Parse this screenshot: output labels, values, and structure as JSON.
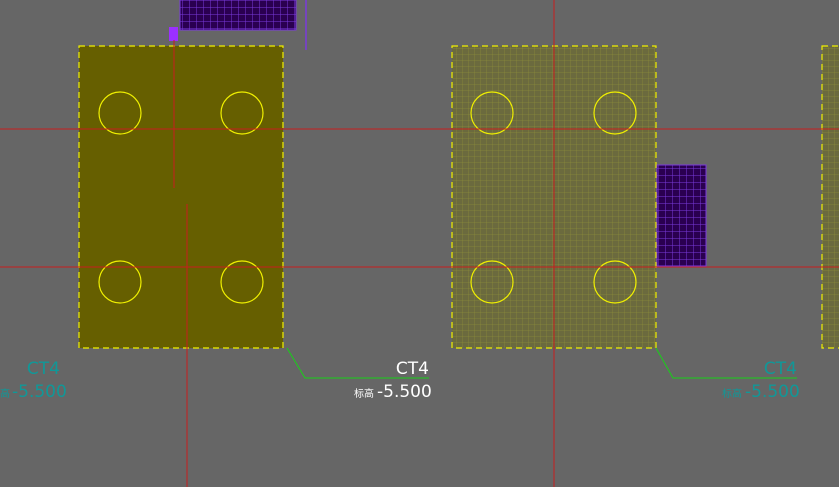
{
  "colors": {
    "background": "#666666",
    "axis_line": "#c81e1e",
    "pile_cap_fill": "#665f00",
    "pile_cap_outline": "#f0f000",
    "pile_circle": "#f0f000",
    "hatch_grid": "#8a8a3a",
    "column_fill": "#2a0050",
    "column_grid": "#7a3adc",
    "leader_line": "#18d018",
    "label_white": "#ffffff",
    "label_teal": "#109898"
  },
  "labels": {
    "left": {
      "code": "CT4",
      "prefix": "标高",
      "elevation": "-5.500"
    },
    "center": {
      "code": "CT4",
      "prefix": "标高",
      "elevation": "-5.500"
    },
    "right": {
      "code": "CT4",
      "prefix": "标高",
      "elevation": "-5.500"
    }
  }
}
